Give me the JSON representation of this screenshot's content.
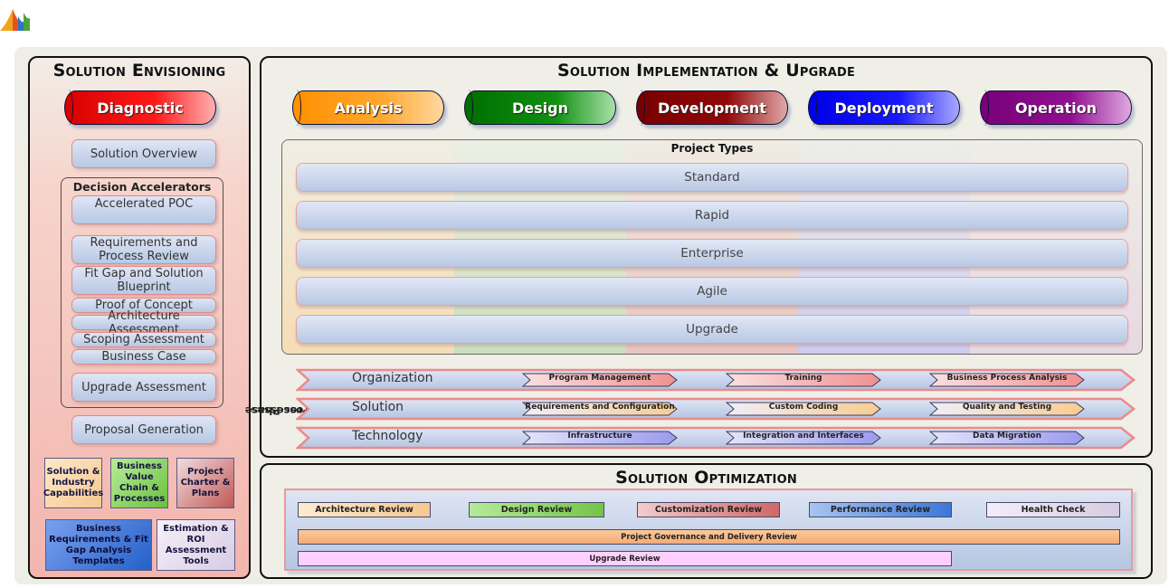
{
  "colors": {
    "diagnostic": "#ee0000",
    "analysis": "#ff9a00",
    "design": "#0a8a10",
    "development": "#8a0a0a",
    "deployment": "#0a10ee",
    "operation": "#8a0a8a"
  },
  "logo": {
    "icon": "dynamics-logo-icon"
  },
  "envisioning": {
    "title": "Solution Envisioning",
    "phase": "Diagnostic",
    "solution_overview": "Solution Overview",
    "decision_accelerators": {
      "title": "Decision Accelerators",
      "items": [
        "Accelerated POC",
        "Requirements and Process Review",
        "Fit Gap and Solution Blueprint",
        "Proof of Concept",
        "Architecture Assessment",
        "Scoping Assessment",
        "Business Case",
        "Upgrade Assessment"
      ]
    },
    "proposal_generation": "Proposal Generation",
    "tools": [
      "Solution & Industry Capabilities",
      "Business Value Chain & Processes",
      "Project Charter & Plans",
      "Business Requirements & Fit Gap Analysis Templates",
      "Estimation & ROI Assessment Tools"
    ]
  },
  "implementation": {
    "title": "Solution Implementation & Upgrade",
    "phases": [
      "Analysis",
      "Design",
      "Development",
      "Deployment",
      "Operation"
    ],
    "project_types": {
      "title": "Project Types",
      "items": [
        "Standard",
        "Rapid",
        "Enterprise",
        "Agile",
        "Upgrade"
      ]
    },
    "cross_phase": {
      "label_line1": "Cross Phase",
      "label_line2": "Processes",
      "rows": [
        {
          "label": "Organization",
          "steps": [
            "Program Management",
            "Training",
            "Business Process Analysis"
          ]
        },
        {
          "label": "Solution",
          "steps": [
            "Requirements and Configuration",
            "Custom Coding",
            "Quality and Testing"
          ]
        },
        {
          "label": "Technology",
          "steps": [
            "Infrastructure",
            "Integration and Interfaces",
            "Data Migration"
          ]
        }
      ]
    }
  },
  "optimization": {
    "title": "Solution Optimization",
    "reviews": [
      "Architecture Review",
      "Design Review",
      "Customization Review",
      "Performance Review",
      "Health Check"
    ],
    "governance": "Project Governance and Delivery Review",
    "upgrade_review": "Upgrade Review"
  }
}
